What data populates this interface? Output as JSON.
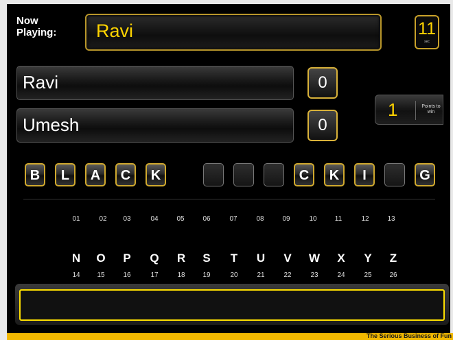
{
  "header": {
    "now_playing_label": "Now Playing:",
    "current_player": "Ravi",
    "timer_value": "11",
    "timer_unit": "sec"
  },
  "players": [
    {
      "name": "Ravi",
      "score": "0"
    },
    {
      "name": "Umesh",
      "score": "0"
    }
  ],
  "points_to_win": {
    "value": "1",
    "label": "Points to win"
  },
  "board": {
    "tiles": [
      "B",
      "L",
      "A",
      "C",
      "K",
      "",
      "",
      "",
      "C",
      "K",
      "I",
      "",
      "G"
    ],
    "tile_numbers": [
      "01",
      "02",
      "03",
      "04",
      "05",
      "06",
      "07",
      "08",
      "09",
      "10",
      "11",
      "12",
      "13"
    ]
  },
  "keyboard": {
    "letters": [
      "N",
      "O",
      "P",
      "Q",
      "R",
      "S",
      "T",
      "U",
      "V",
      "W",
      "X",
      "Y",
      "Z"
    ],
    "numbers": [
      "14",
      "15",
      "16",
      "17",
      "18",
      "19",
      "20",
      "21",
      "22",
      "23",
      "24",
      "25",
      "26"
    ]
  },
  "answer_input": {
    "value": ""
  },
  "footer": {
    "tagline": "The Serious Business of Fun"
  },
  "colors": {
    "accent": "#ffd400",
    "gold_border": "#c9a22a",
    "footer": "#f2b800",
    "background": "#000000"
  }
}
